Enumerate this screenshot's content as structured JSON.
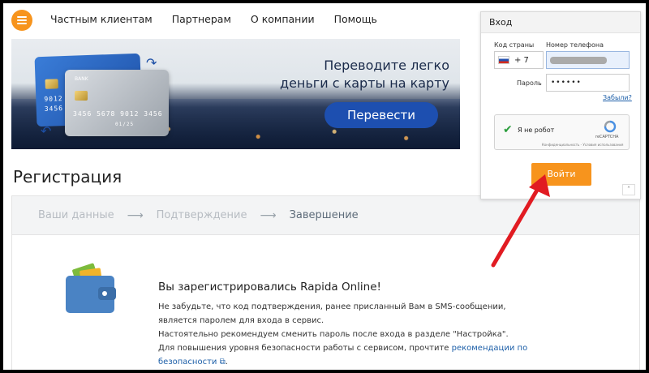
{
  "header": {
    "nav": [
      "Частным клиентам",
      "Партнерам",
      "О компании",
      "Помощь"
    ]
  },
  "banner": {
    "line1": "Переводите легко",
    "line2": "деньги с карты на карту",
    "button": "Перевести",
    "card_blue": {
      "number": "9012",
      "number2": "3456"
    },
    "card_silver": {
      "bank": "BANK",
      "number": "3456 5678 9012 3456",
      "expiry": "01/25"
    }
  },
  "registration": {
    "title": "Регистрация",
    "steps": [
      "Ваши данные",
      "Подтверждение",
      "Завершение"
    ],
    "success_title": "Вы зарегистрировались Rapida Online!",
    "lines": [
      "Не забудьте, что код подтверждения, ранее присланный Вам в SMS-сообщении,",
      "является паролем для входа в сервис.",
      "Настоятельно рекомендуем сменить пароль после входа в разделе \"Настройка\".",
      "Для повышения уровня безопасности работы с сервисом, прочтите "
    ],
    "security_link": "рекомендации по безопасности",
    "trailing": "."
  },
  "login": {
    "title": "Вход",
    "country_label": "Код страны",
    "phone_label": "Номер телефона",
    "country_code": "+ 7",
    "password_label": "Пароль",
    "password_value": "••••••",
    "forgot": "Забыли?",
    "captcha_text": "Я не робот",
    "captcha_brand": "reCAPTCHA",
    "captcha_terms": "Конфиденциальность - Условия использования",
    "submit": "Войти"
  },
  "colors": {
    "accent": "#f7941d",
    "link": "#1d5fa8",
    "banner_button": "#1d4fb0",
    "arrow": "#e11b22"
  }
}
